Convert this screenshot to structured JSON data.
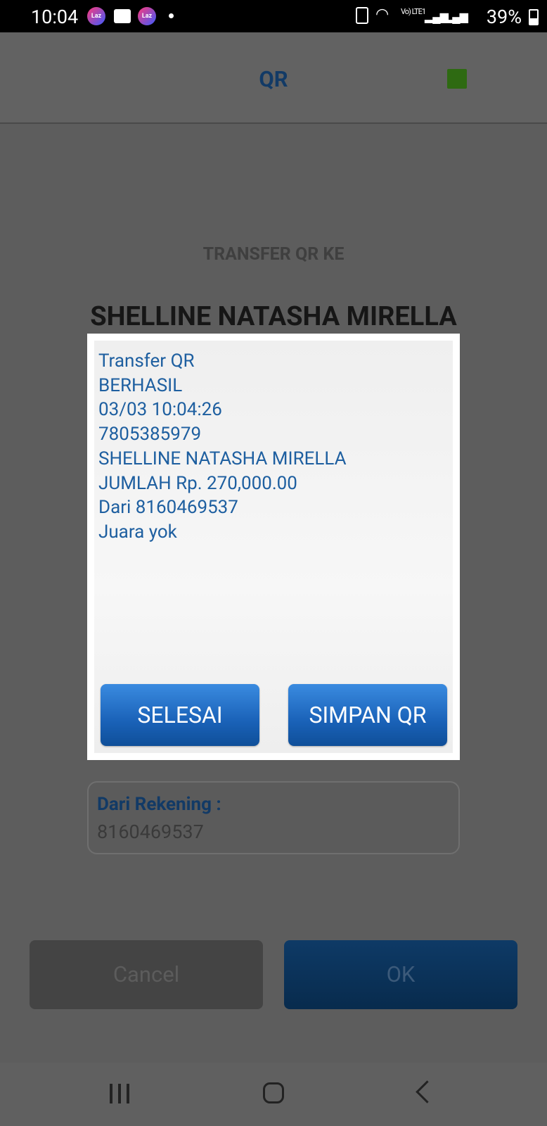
{
  "status_bar": {
    "time": "10:04",
    "battery": "39%",
    "network": "Vo) LTE1"
  },
  "app_bar": {
    "title": "QR",
    "indicator_color": "#2e6a12"
  },
  "background": {
    "transfer_label": "TRANSFER QR KE",
    "recipient_name": "SHELLINE NATASHA MIRELLA",
    "from_account_label": "Dari Rekening :",
    "from_account_value": "8160469537",
    "cancel_label": "Cancel",
    "ok_label": "OK"
  },
  "dialog": {
    "lines": [
      "Transfer QR",
      "BERHASIL",
      "03/03 10:04:26",
      "7805385979",
      "SHELLINE NATASHA MIRELLA",
      "JUMLAH Rp. 270,000.00",
      "Dari 8160469537",
      "Juara yok"
    ],
    "done_label": "SELESAI",
    "save_label": "SIMPAN QR"
  }
}
